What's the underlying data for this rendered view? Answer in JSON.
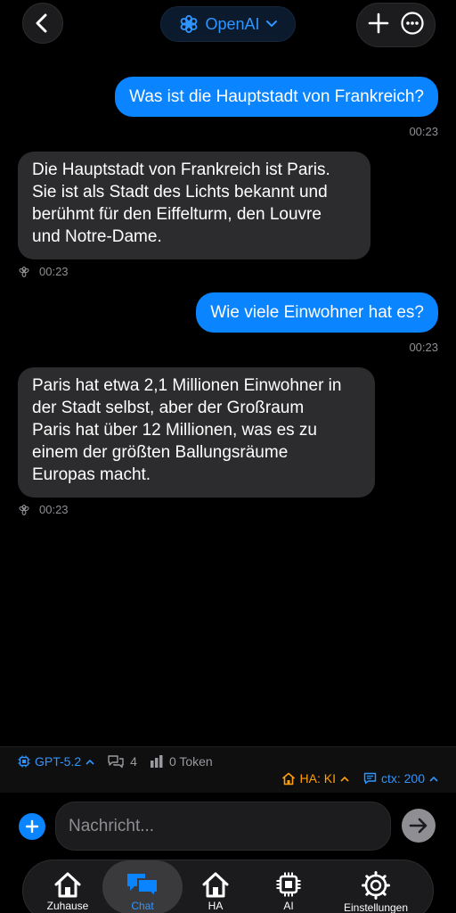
{
  "header": {
    "provider_label": "OpenAI"
  },
  "messages": [
    {
      "role": "user",
      "text": "Was ist die Hauptstadt von Frankreich?",
      "time": "00:23"
    },
    {
      "role": "assistant",
      "lines": [
        "Die Hauptstadt von Frankreich ist Paris.",
        "Sie ist als Stadt des Lichts bekannt und",
        "berühmt für den Eiffelturm, den Louvre",
        "und Notre-Dame."
      ],
      "time": "00:23"
    },
    {
      "role": "user",
      "text": "Wie viele Einwohner hat es?",
      "time": "00:23"
    },
    {
      "role": "assistant",
      "lines": [
        "Paris hat etwa 2,1 Millionen Einwohner in",
        "der Stadt selbst, aber der Großraum",
        "Paris hat über 12 Millionen, was es zu",
        "einem der größten Ballungsräume",
        "Europas macht."
      ],
      "time": "00:23"
    }
  ],
  "status": {
    "model": "GPT-5.2",
    "conversations_count": "4",
    "tokens": "0 Token",
    "ha_label": "HA: KI",
    "ctx_label": "ctx: 200"
  },
  "composer": {
    "placeholder": "Nachricht..."
  },
  "tabs": [
    {
      "label": "Zuhause",
      "icon": "home-icon"
    },
    {
      "label": "Chat",
      "icon": "chat-icon",
      "active": true
    },
    {
      "label": "HA",
      "icon": "home-assistant-icon"
    },
    {
      "label": "AI",
      "icon": "chip-icon"
    },
    {
      "label": "Einstellungen",
      "icon": "gear-icon"
    }
  ],
  "colors": {
    "accent": "#0a84ff",
    "ha": "#ff9f0a",
    "bubble_assistant": "#2c2c2e"
  }
}
